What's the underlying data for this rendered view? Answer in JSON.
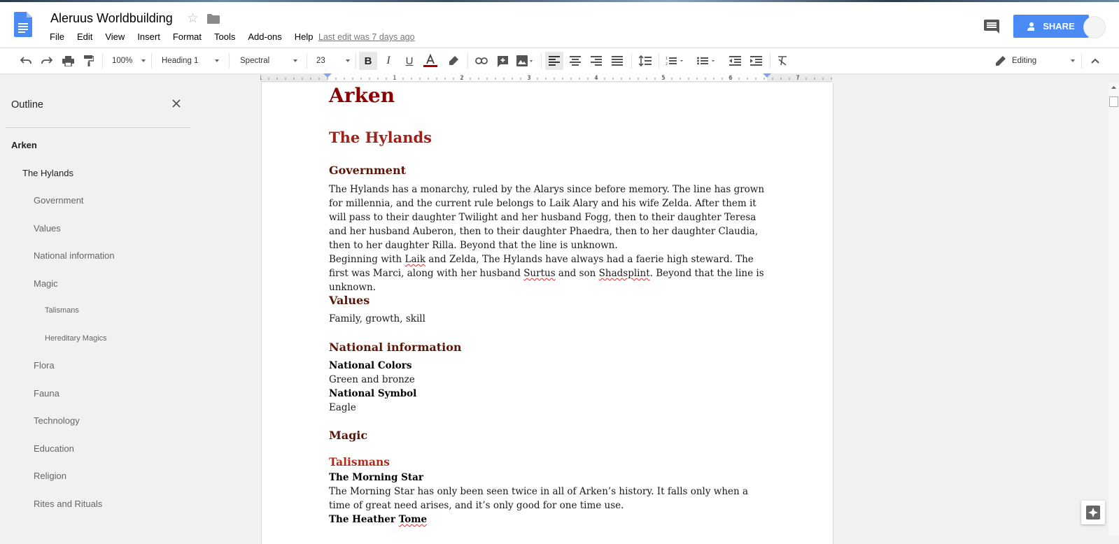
{
  "app": {
    "doc_title": "Aleruus Worldbuilding",
    "last_edit": "Last edit was 7 days ago",
    "share_label": "SHARE",
    "menus": [
      "File",
      "Edit",
      "View",
      "Insert",
      "Format",
      "Tools",
      "Add-ons",
      "Help"
    ]
  },
  "toolbar": {
    "zoom": "100%",
    "style": "Heading 1",
    "font": "Spectral",
    "size": "23",
    "mode": "Editing"
  },
  "outline": {
    "title": "Outline",
    "items": [
      "Arken",
      "The Hylands",
      "Government",
      "Values",
      "National information",
      "Magic",
      "Talismans",
      "Hereditary Magics",
      "Flora",
      "Fauna",
      "Technology",
      "Education",
      "Religion",
      "Rites and Rituals"
    ]
  },
  "document": {
    "h_arken": "Arken",
    "h_hylands": "The Hylands",
    "h_government": "Government",
    "gov_para": "The Hylands has a monarchy, ruled by the Alarys since before memory. The line has grown for millennia, and the current rule belongs to Laik Alary and his wife Zelda. After them it will pass to their daughter Twilight and her husband Fogg, then to their daughter Teresa and her husband Auberon, then to their daughter Phaedra, then to her daughter Claudia, then to her daughter Rilla. Beyond that the line is unknown.",
    "steward_1": "Beginning with ",
    "steward_laik": "Laik",
    "steward_2": " and Zelda, The Hylands have always had a faerie high steward. The first was Marci, along with her husband ",
    "steward_surtus": "Surtus",
    "steward_3": " and son ",
    "steward_shad": "Shadsplint",
    "steward_4": ". Beyond that the line is unknown.",
    "h_values": "Values",
    "values_text": "Family, growth, skill",
    "h_national": "National information",
    "colors_label": "National Colors",
    "colors_value": "Green and bronze",
    "symbol_label": "National Symbol",
    "symbol_value": "Eagle",
    "h_magic": "Magic",
    "h_talismans": "Talismans",
    "morning_star_label": "The Morning Star",
    "morning_star_text": "The Morning Star has only been seen twice in all of Arken’s history. It falls only when a time of great need arises, and it’s only good for one time use.",
    "heather_a": "The Heather ",
    "heather_b": "Tome"
  },
  "ruler_numbers": [
    "1",
    "1",
    "2",
    "3",
    "4",
    "5",
    "6",
    "7"
  ],
  "colors": {
    "accent": "#4a8af4",
    "heading_dark": "#8b0000",
    "heading_red": "#a0201a"
  }
}
